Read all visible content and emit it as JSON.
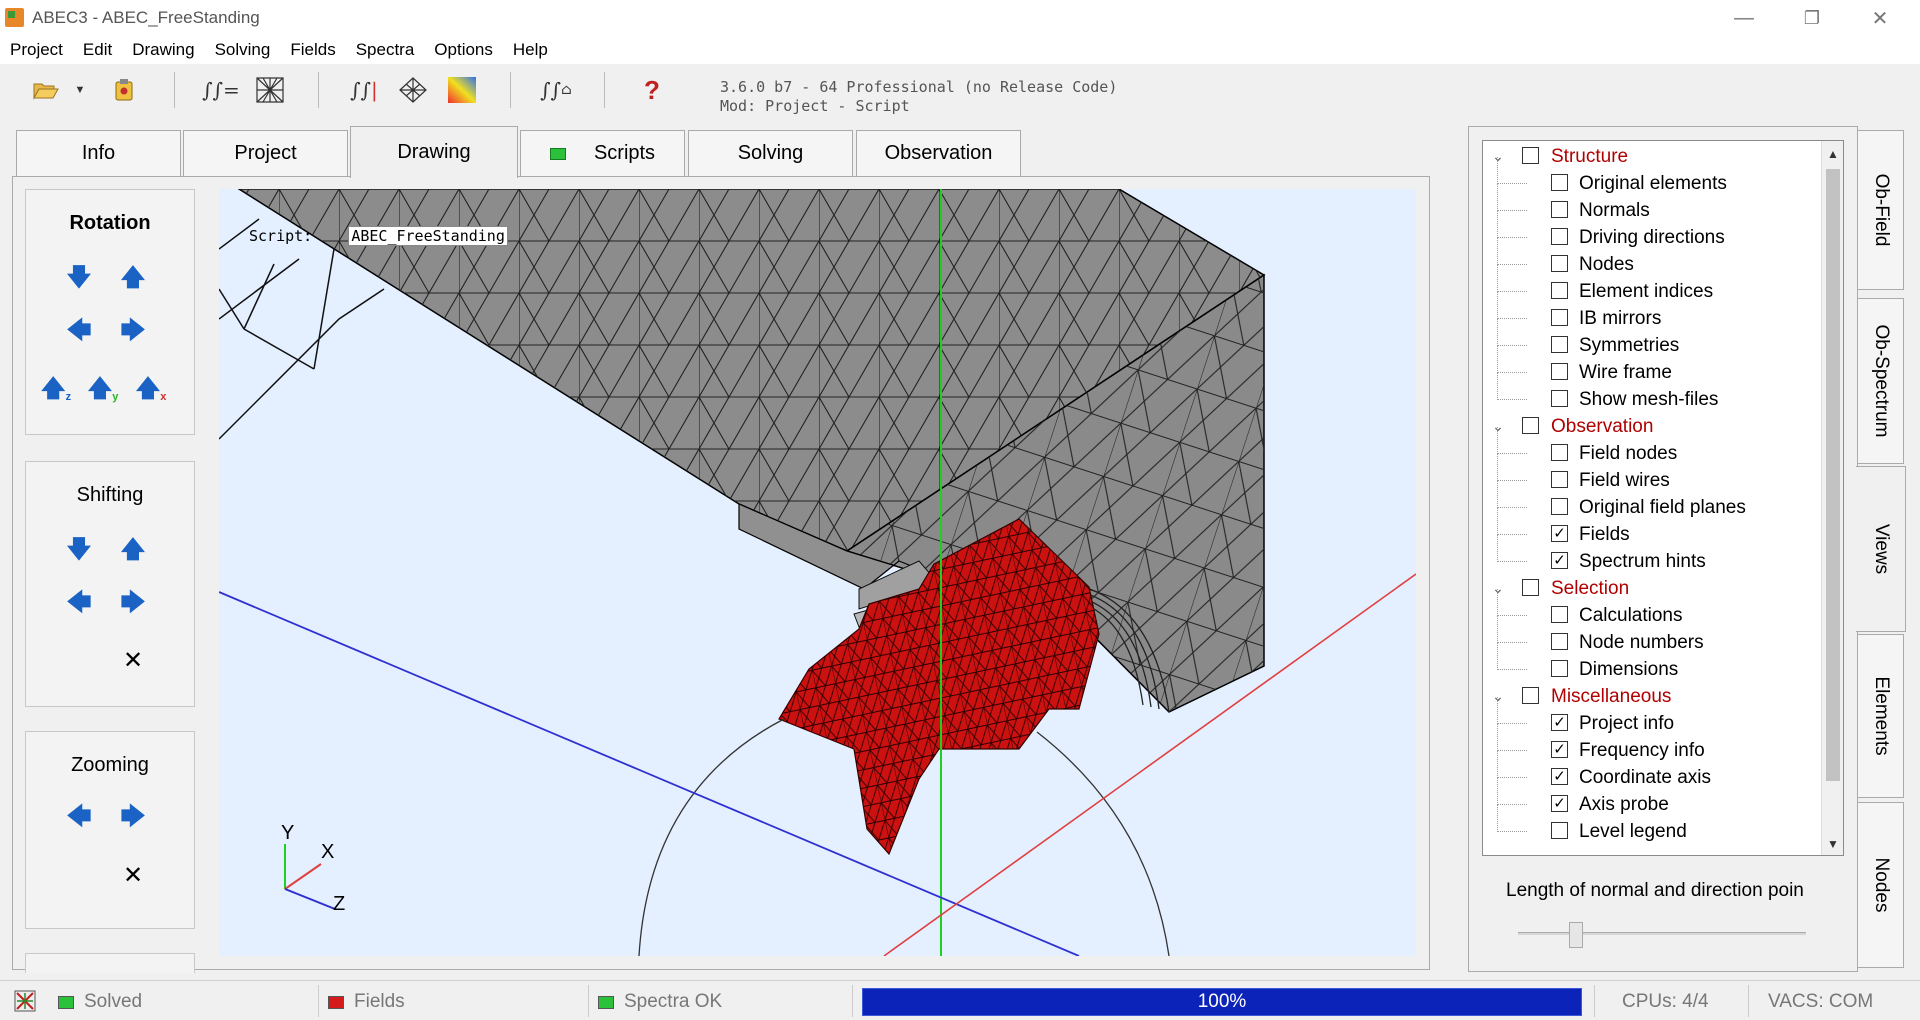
{
  "window": {
    "title": "ABEC3 - ABEC_FreeStanding",
    "minimize": "—",
    "restore": "❐",
    "close": "✕"
  },
  "menu": [
    "Project",
    "Edit",
    "Drawing",
    "Solving",
    "Fields",
    "Spectra",
    "Options",
    "Help"
  ],
  "toolbar": {
    "version_line1": "3.6.0 b7 - 64 Professional (no Release Code)",
    "version_line2": "Mod: Project - Script",
    "icons": [
      "open-folder-icon",
      "dropdown-arrow-icon",
      "save-icon",
      "integral-equals-icon",
      "mesh-grid-icon",
      "integral-color-icon",
      "mesh-diamond-icon",
      "gradient-icon",
      "integral-plot-icon",
      "help-icon"
    ]
  },
  "tabs": {
    "info": "Info",
    "project": "Project",
    "drawing": "Drawing",
    "scripts": "Scripts",
    "solving": "Solving",
    "observation": "Observation",
    "active": "Drawing"
  },
  "controls": {
    "rotation": "Rotation",
    "shifting": "Shifting",
    "zooming": "Zooming",
    "rotate_z": "z",
    "rotate_y": "y",
    "rotate_x": "x"
  },
  "viewport": {
    "script_label": "Script:",
    "script_value": "ABEC_FreeStanding",
    "axis_y": "Y",
    "axis_x": "X",
    "axis_z": "Z",
    "colors": {
      "background": "#e4efff",
      "structure": "#8c8c8c",
      "field": "#cc1111",
      "axis_x": "#e04040",
      "axis_y": "#20d020",
      "axis_z": "#3030d0"
    }
  },
  "tree": {
    "groups": [
      {
        "label": "Structure",
        "checked": false,
        "expanded": true,
        "items": [
          {
            "label": "Original elements",
            "checked": false
          },
          {
            "label": "Normals",
            "checked": false
          },
          {
            "label": "Driving directions",
            "checked": false
          },
          {
            "label": "Nodes",
            "checked": false
          },
          {
            "label": "Element indices",
            "checked": false
          },
          {
            "label": "IB mirrors",
            "checked": false
          },
          {
            "label": "Symmetries",
            "checked": false
          },
          {
            "label": "Wire frame",
            "checked": false
          },
          {
            "label": "Show mesh-files",
            "checked": false
          }
        ]
      },
      {
        "label": "Observation",
        "checked": false,
        "expanded": true,
        "items": [
          {
            "label": "Field nodes",
            "checked": false
          },
          {
            "label": "Field wires",
            "checked": false
          },
          {
            "label": "Original field planes",
            "checked": false
          },
          {
            "label": "Fields",
            "checked": true
          },
          {
            "label": "Spectrum hints",
            "checked": true
          }
        ]
      },
      {
        "label": "Selection",
        "checked": false,
        "expanded": true,
        "items": [
          {
            "label": "Calculations",
            "checked": false
          },
          {
            "label": "Node numbers",
            "checked": false
          },
          {
            "label": "Dimensions",
            "checked": false
          }
        ]
      },
      {
        "label": "Miscellaneous",
        "checked": false,
        "expanded": true,
        "items": [
          {
            "label": "Project info",
            "checked": true
          },
          {
            "label": "Frequency info",
            "checked": true
          },
          {
            "label": "Coordinate axis",
            "checked": true
          },
          {
            "label": "Axis probe",
            "checked": true
          },
          {
            "label": "Level legend",
            "checked": false
          }
        ]
      }
    ]
  },
  "normal_length_label": "Length of normal and direction poin",
  "normal_length_value": 0.18,
  "side_tabs": [
    "Ob-Field",
    "Ob-Spectrum",
    "Views",
    "Elements",
    "Nodes"
  ],
  "side_tab_active": "Views",
  "status": {
    "solved": "Solved",
    "fields": "Fields",
    "spectra": "Spectra OK",
    "progress": "100%",
    "progress_value": 1.0,
    "cpus": "CPUs: 4/4",
    "vacs": "VACS: COM"
  }
}
